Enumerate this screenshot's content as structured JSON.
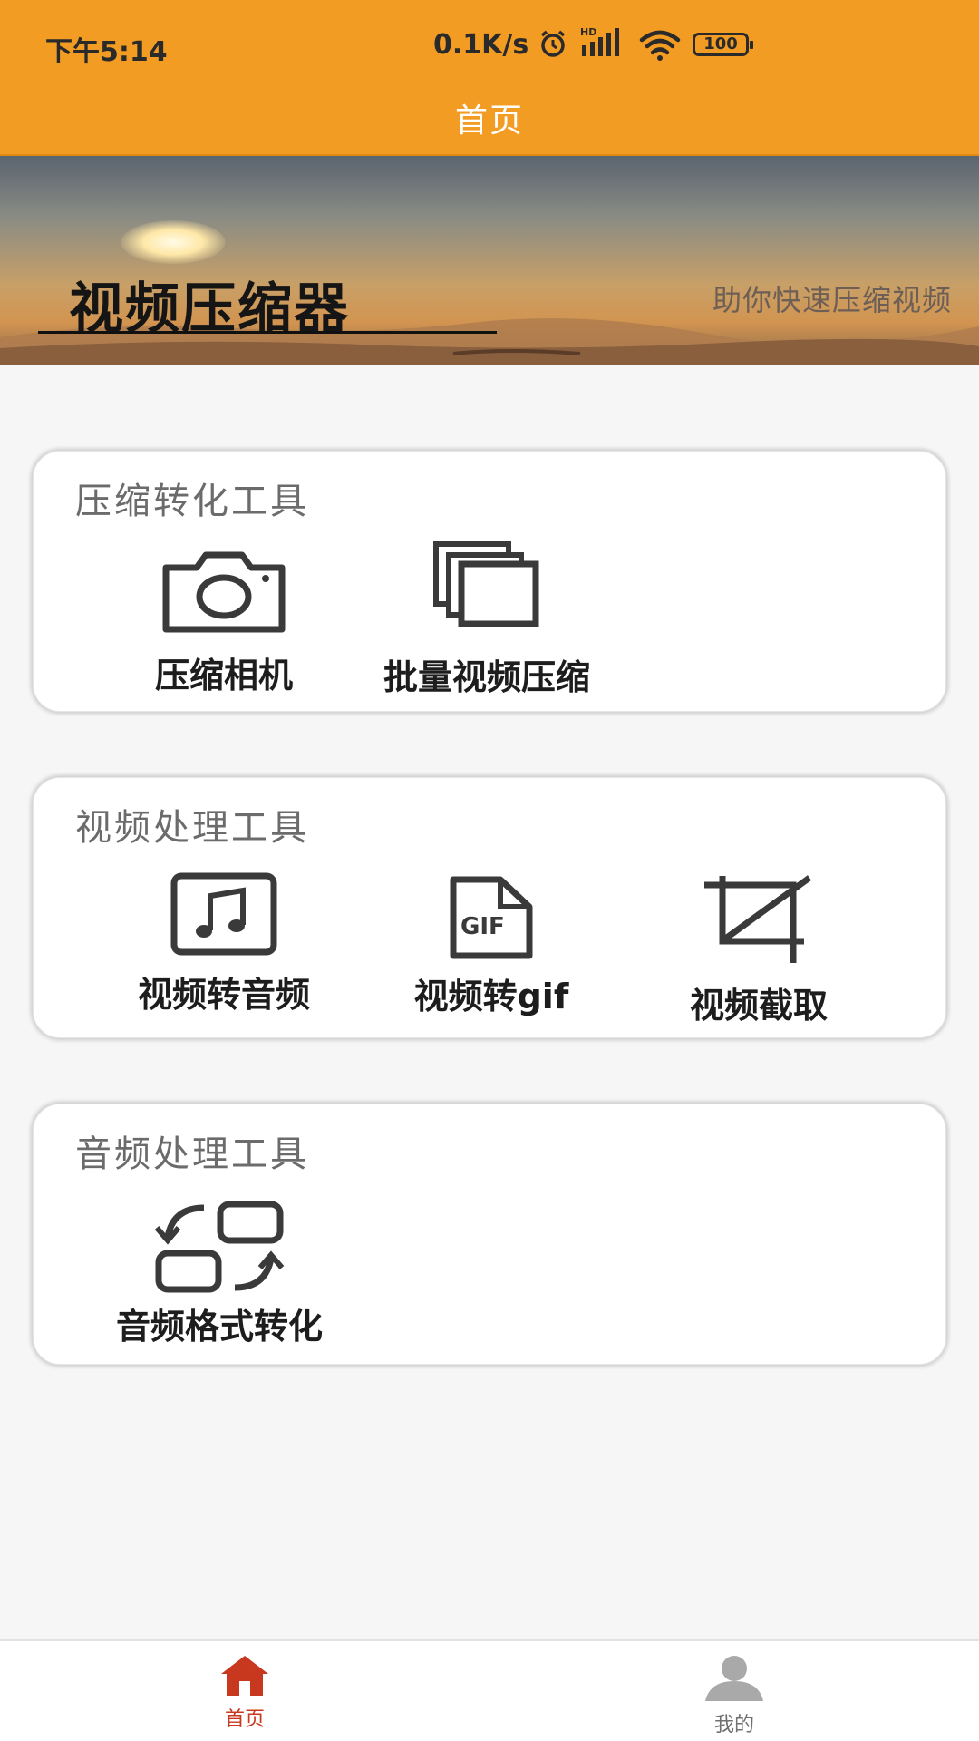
{
  "status_bar": {
    "time": "下午5:14",
    "net_speed": "0.1K/s",
    "signal_label": "HD",
    "battery": "100"
  },
  "header": {
    "title": "首页"
  },
  "banner": {
    "title": "视频压缩器",
    "subtitle": "助你快速压缩视频"
  },
  "sections": [
    {
      "title": "压缩转化工具",
      "tools": [
        {
          "label": "压缩相机",
          "icon": "camera-icon"
        },
        {
          "label": "批量视频压缩",
          "icon": "stacked-files-icon"
        }
      ]
    },
    {
      "title": "视频处理工具",
      "tools": [
        {
          "label": "视频转音频",
          "icon": "music-note-icon"
        },
        {
          "label": "视频转gif",
          "icon": "gif-file-icon"
        },
        {
          "label": "视频截取",
          "icon": "crop-icon"
        }
      ]
    },
    {
      "title": "音频处理工具",
      "tools": [
        {
          "label": "音频格式转化",
          "icon": "swap-format-icon"
        }
      ]
    }
  ],
  "bottom_nav": {
    "items": [
      {
        "label": "首页",
        "icon": "home-icon",
        "active": true
      },
      {
        "label": "我的",
        "icon": "person-icon",
        "active": false
      }
    ]
  },
  "colors": {
    "header": "#f39c24",
    "nav_active": "#c8381f",
    "icon": "#3a3a3a"
  }
}
